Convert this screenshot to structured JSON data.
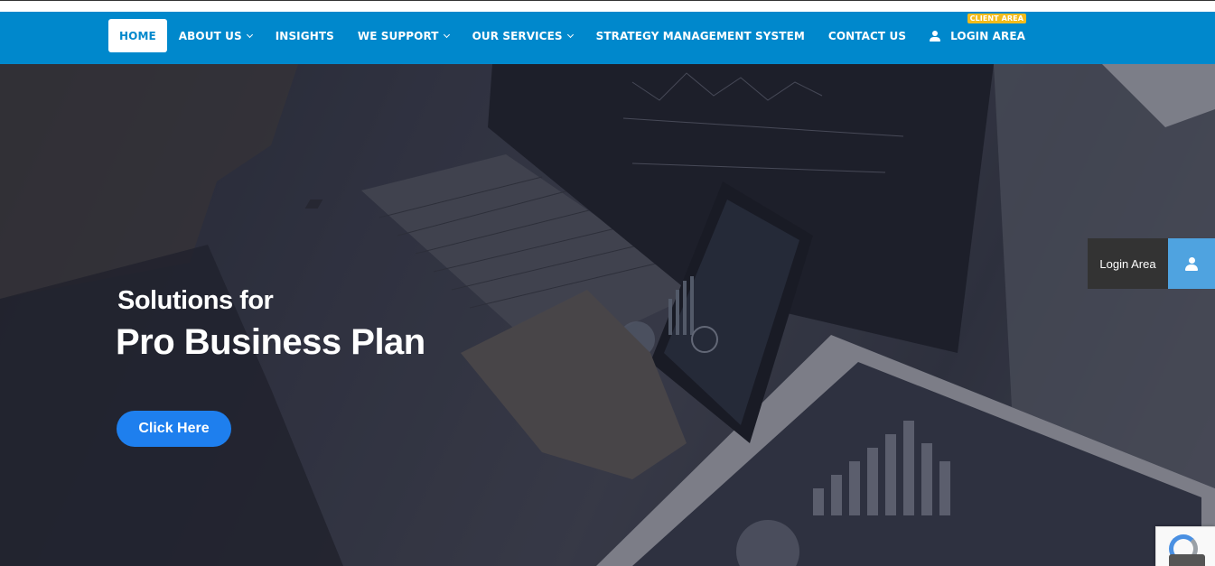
{
  "nav": {
    "items": [
      {
        "label": "HOME",
        "active": true,
        "dropdown": false
      },
      {
        "label": "ABOUT US",
        "active": false,
        "dropdown": true
      },
      {
        "label": "INSIGHTS",
        "active": false,
        "dropdown": false
      },
      {
        "label": "WE SUPPORT",
        "active": false,
        "dropdown": true
      },
      {
        "label": "OUR SERVICES",
        "active": false,
        "dropdown": true
      },
      {
        "label": "STRATEGY MANAGEMENT SYSTEM",
        "active": false,
        "dropdown": false
      },
      {
        "label": "CONTACT US",
        "active": false,
        "dropdown": false
      }
    ],
    "login": {
      "label": "LOGIN AREA",
      "badge": "CLIENT AREA",
      "icon": "user-icon"
    }
  },
  "hero": {
    "subtitle": "Solutions for",
    "title": "Pro Business Plan",
    "button_label": "Click Here"
  },
  "side_login": {
    "label": "Login Area",
    "icon": "user-icon"
  },
  "colors": {
    "nav_background": "#0088cc",
    "badge": "#f3bc1b",
    "button": "#1e7fee",
    "side_icon_box": "#4fa3e0",
    "side_label_box": "#333333"
  }
}
